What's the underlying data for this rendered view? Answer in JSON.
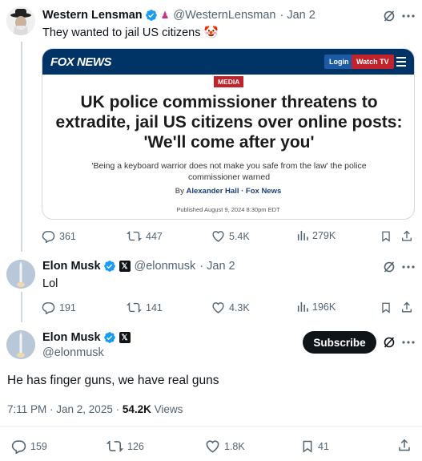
{
  "tweet1": {
    "name": "Western Lensman",
    "handle": "@WesternLensman",
    "date": "· Jan 2",
    "text": "They wanted to jail US citizens 🤡",
    "card": {
      "logo": "FOX NEWS",
      "login": "Login",
      "watch": "Watch TV",
      "tag": "MEDIA",
      "headline": "UK police commissioner threatens to extradite, jail US citizens over online posts: 'We'll come after you'",
      "subhead": "'Being a keyboard warrior does not make you safe from the law' the police commissioner warned",
      "by": "By",
      "author": "Alexander Hall",
      "outlet": "· Fox News",
      "published": "Published August 9, 2024 8:30pm EDT"
    },
    "stats": {
      "replies": "361",
      "reposts": "447",
      "likes": "5.4K",
      "views": "279K"
    }
  },
  "tweet2": {
    "name": "Elon Musk",
    "handle": "@elonmusk",
    "date": "· Jan 2",
    "text": "Lol",
    "stats": {
      "replies": "191",
      "reposts": "141",
      "likes": "4.3K",
      "views": "196K"
    }
  },
  "tweet3": {
    "name": "Elon Musk",
    "handle": "@elonmusk",
    "subscribe": "Subscribe",
    "text": "He has finger guns, we have real guns",
    "time": "7:11 PM · Jan 2, 2025 ·",
    "views_count": "54.2K",
    "views_label": "Views",
    "stats": {
      "replies": "159",
      "reposts": "126",
      "likes": "1.8K",
      "bookmarks": "41"
    }
  },
  "colors": {
    "accent": "#1d9bf0",
    "fox_blue": "#003366",
    "fox_red": "#c0232c",
    "text": "#0f1419",
    "muted": "#536471"
  }
}
